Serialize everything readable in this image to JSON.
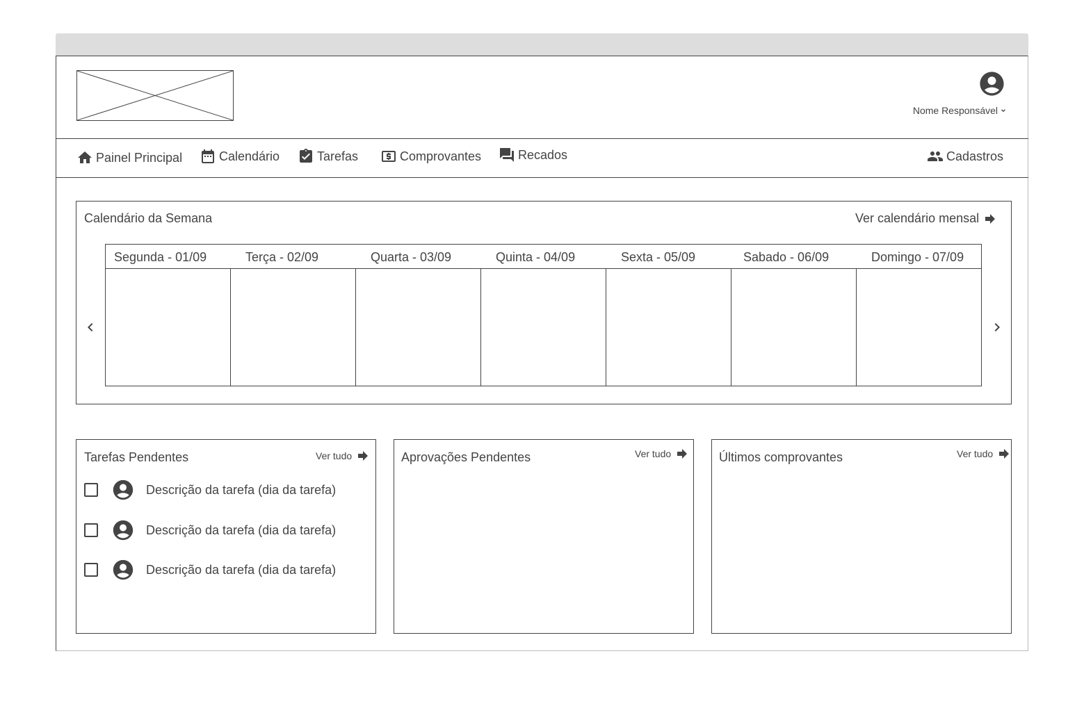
{
  "header": {
    "user_name": "Nome Responsável"
  },
  "nav": {
    "items": [
      {
        "label": "Painel Principal",
        "icon": "home-icon"
      },
      {
        "label": "Calendário",
        "icon": "calendar-icon"
      },
      {
        "label": "Tarefas",
        "icon": "clipboard-check-icon"
      },
      {
        "label": "Comprovantes",
        "icon": "dollar-receipt-icon"
      },
      {
        "label": "Recados",
        "icon": "chat-icon"
      }
    ],
    "right_item": {
      "label": "Cadastros",
      "icon": "people-icon"
    }
  },
  "week_calendar": {
    "title": "Calendário da Semana",
    "link": "Ver calendário mensal",
    "days": [
      "Segunda - 01/09",
      "Terça - 02/09",
      "Quarta - 03/09",
      "Quinta - 04/09",
      "Sexta - 05/09",
      "Sabado - 06/09",
      "Domingo - 07/09"
    ]
  },
  "tasks_panel": {
    "title": "Tarefas Pendentes",
    "link": "Ver tudo",
    "items": [
      "Descrição da tarefa (dia da tarefa)",
      "Descrição da tarefa (dia da tarefa)",
      "Descrição da tarefa (dia da tarefa)"
    ]
  },
  "approvals_panel": {
    "title": "Aprovações Pendentes",
    "link": "Ver tudo"
  },
  "receipts_panel": {
    "title": "Últimos comprovantes",
    "link": "Ver tudo"
  }
}
